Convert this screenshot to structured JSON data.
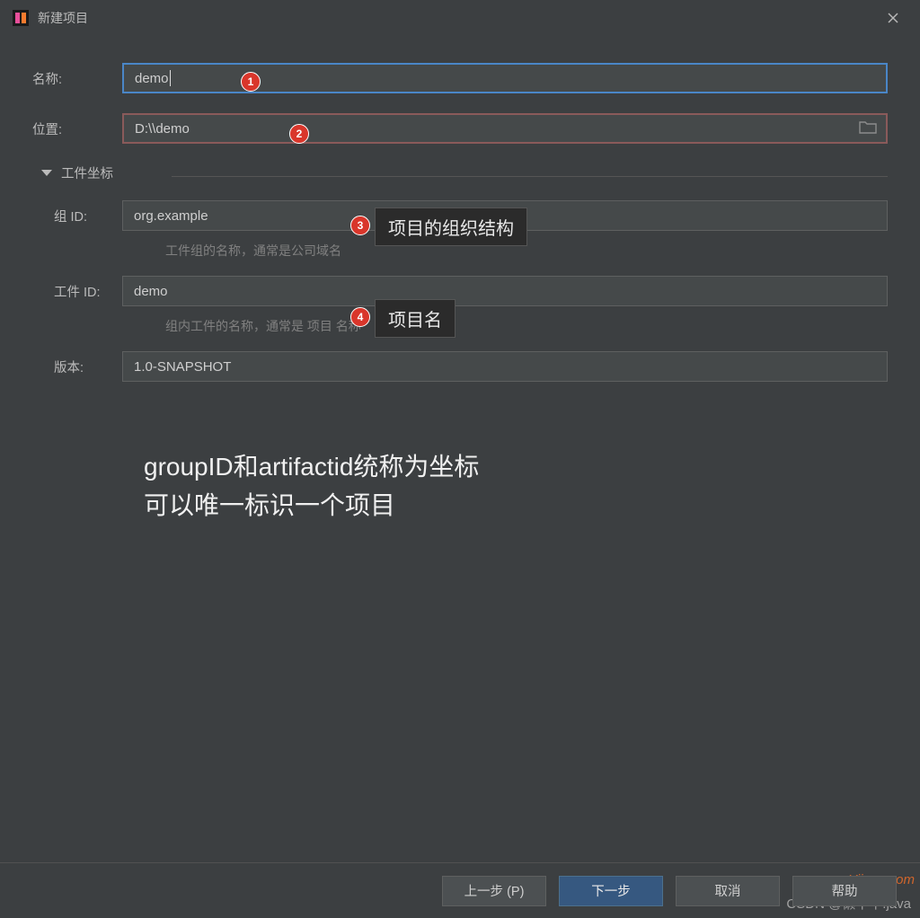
{
  "window": {
    "title": "新建项目"
  },
  "form": {
    "name_label": "名称:",
    "name_value": "demo",
    "location_label": "位置:",
    "location_value": "D:\\\\demo",
    "coords_section": "工件坐标",
    "group_id_label": "组 ID:",
    "group_id_value": "org.example",
    "group_id_hint": "工件组的名称，通常是公司域名",
    "artifact_id_label": "工件 ID:",
    "artifact_id_value": "demo",
    "artifact_id_hint": "组内工件的名称，通常是 项目 名称",
    "version_label": "版本:",
    "version_value": "1.0-SNAPSHOT"
  },
  "annotations": {
    "b1": "1",
    "b2": "2",
    "b3": "3",
    "b4": "4",
    "tip3": "项目的组织结构",
    "tip4": "项目名",
    "note_line1": "groupID和artifactid统称为坐标",
    "note_line2": "可以唯一标识一个项目"
  },
  "footer": {
    "prev": "上一步 (P)",
    "next": "下一步",
    "cancel": "取消",
    "help": "帮助"
  },
  "watermark": {
    "site": "Yiiuen.com",
    "credit": "CSDN @懒羊羊.java"
  }
}
